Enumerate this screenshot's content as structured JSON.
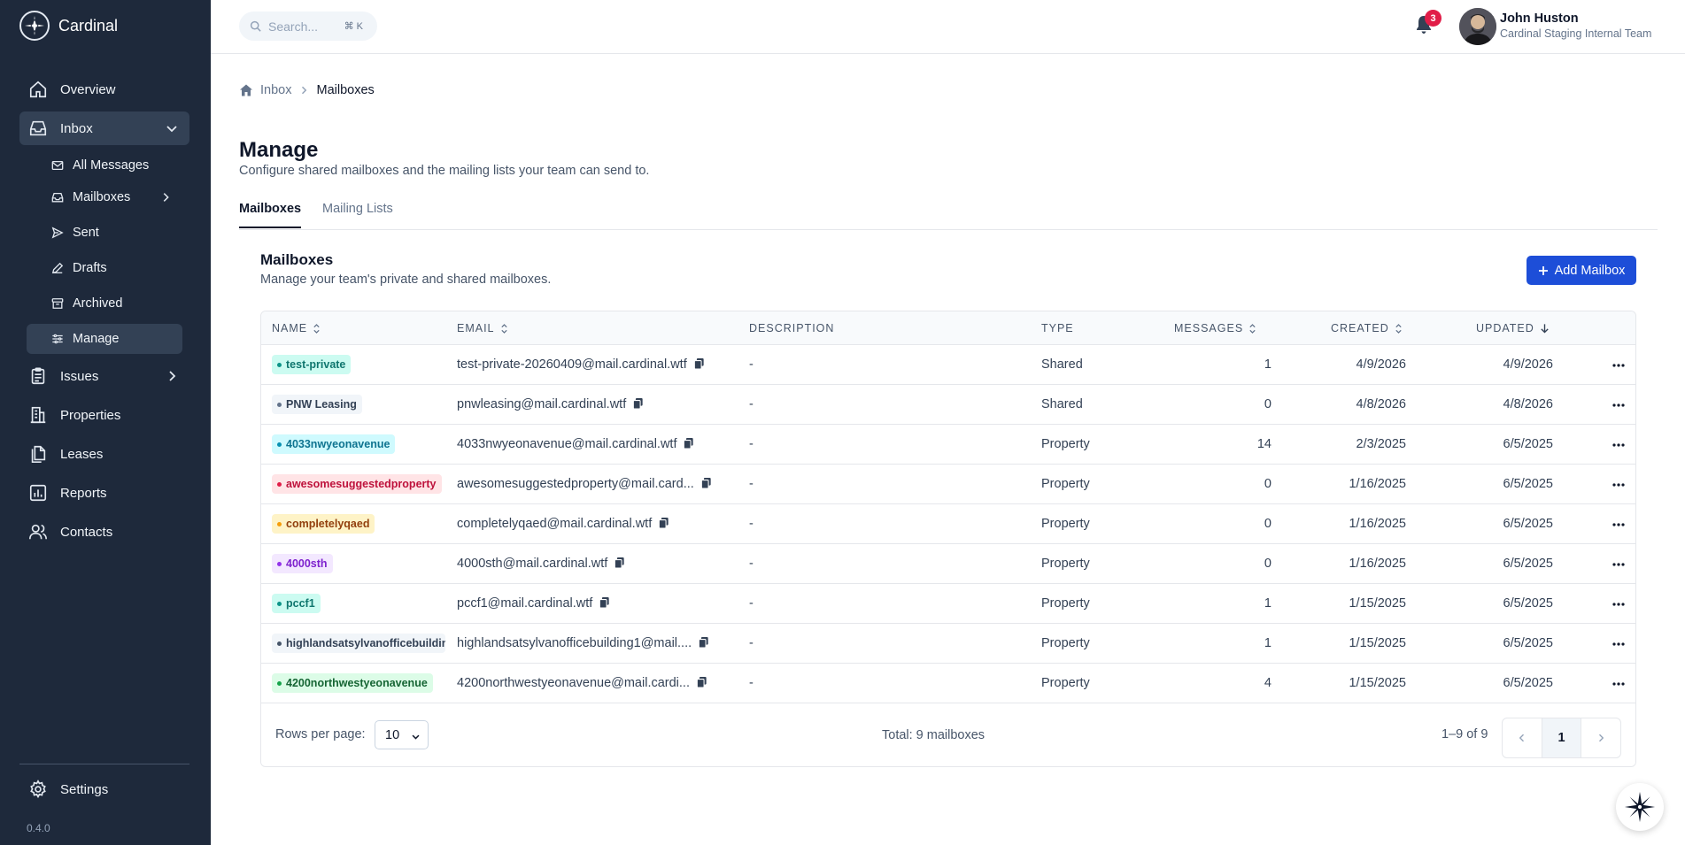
{
  "app": {
    "name": "Cardinal",
    "version": "0.4.0"
  },
  "sidebar": {
    "items": [
      {
        "label": "Overview",
        "icon": "home-icon"
      },
      {
        "label": "Inbox",
        "icon": "inbox-icon"
      },
      {
        "label": "Issues",
        "icon": "clipboard-icon"
      },
      {
        "label": "Properties",
        "icon": "building-icon"
      },
      {
        "label": "Leases",
        "icon": "documents-icon"
      },
      {
        "label": "Reports",
        "icon": "chart-icon"
      },
      {
        "label": "Contacts",
        "icon": "users-icon"
      }
    ],
    "inbox_sub": [
      {
        "label": "All Messages",
        "icon": "mail-icon"
      },
      {
        "label": "Mailboxes",
        "icon": "mailbox-icon"
      },
      {
        "label": "Sent",
        "icon": "send-icon"
      },
      {
        "label": "Drafts",
        "icon": "pencil-icon"
      },
      {
        "label": "Archived",
        "icon": "archive-icon"
      },
      {
        "label": "Manage",
        "icon": "sliders-icon"
      }
    ],
    "settings": "Settings"
  },
  "topbar": {
    "search_placeholder": "Search...",
    "search_shortcut": "⌘ K",
    "notification_count": "3",
    "user_name": "John Huston",
    "user_team": "Cardinal Staging Internal Team"
  },
  "breadcrumb": {
    "home": "Inbox",
    "current": "Mailboxes"
  },
  "page": {
    "title": "Manage",
    "subtitle": "Configure shared mailboxes and the mailing lists your team can send to.",
    "tabs": [
      "Mailboxes",
      "Mailing Lists"
    ]
  },
  "card": {
    "title": "Mailboxes",
    "subtitle": "Manage your team's private and shared mailboxes.",
    "add_button": "Add Mailbox"
  },
  "table": {
    "columns": [
      "NAME",
      "EMAIL",
      "DESCRIPTION",
      "TYPE",
      "MESSAGES",
      "CREATED",
      "UPDATED"
    ],
    "rows": [
      {
        "name": "test-private",
        "color": "#0d9488",
        "bg": "#ccfbf1",
        "fg": "#0f766e",
        "email": "test-private-20260409@mail.cardinal.wtf",
        "description": "-",
        "type": "Shared",
        "messages": "1",
        "created": "4/9/2026",
        "updated": "4/9/2026"
      },
      {
        "name": "PNW Leasing",
        "color": "#64748b",
        "bg": "#f1f5f9",
        "fg": "#334155",
        "email": "pnwleasing@mail.cardinal.wtf",
        "description": "-",
        "type": "Shared",
        "messages": "0",
        "created": "4/8/2026",
        "updated": "4/8/2026"
      },
      {
        "name": "4033nwyeonavenue",
        "color": "#0891b2",
        "bg": "#cffafe",
        "fg": "#0e7490",
        "email": "4033nwyeonavenue@mail.cardinal.wtf",
        "description": "-",
        "type": "Property",
        "messages": "14",
        "created": "2/3/2025",
        "updated": "6/5/2025"
      },
      {
        "name": "awesomesuggestedproperty",
        "color": "#e11d48",
        "bg": "#ffe4e6",
        "fg": "#be123c",
        "email": "awesomesuggestedproperty@mail.card...",
        "description": "-",
        "type": "Property",
        "messages": "0",
        "created": "1/16/2025",
        "updated": "6/5/2025"
      },
      {
        "name": "completelyqaed",
        "color": "#f59e0b",
        "bg": "#fef3c7",
        "fg": "#92400e",
        "email": "completelyqaed@mail.cardinal.wtf",
        "description": "-",
        "type": "Property",
        "messages": "0",
        "created": "1/16/2025",
        "updated": "6/5/2025"
      },
      {
        "name": "4000sth",
        "color": "#9333ea",
        "bg": "#f3e8ff",
        "fg": "#7e22ce",
        "email": "4000sth@mail.cardinal.wtf",
        "description": "-",
        "type": "Property",
        "messages": "0",
        "created": "1/16/2025",
        "updated": "6/5/2025"
      },
      {
        "name": "pccf1",
        "color": "#0d9488",
        "bg": "#ccfbf1",
        "fg": "#0f766e",
        "email": "pccf1@mail.cardinal.wtf",
        "description": "-",
        "type": "Property",
        "messages": "1",
        "created": "1/15/2025",
        "updated": "6/5/2025"
      },
      {
        "name": "highlandsatsylvanofficebuildin",
        "color": "#475569",
        "bg": "#f1f5f9",
        "fg": "#334155",
        "email": "highlandsatsylvanofficebuilding1@mail....",
        "description": "-",
        "type": "Property",
        "messages": "1",
        "created": "1/15/2025",
        "updated": "6/5/2025"
      },
      {
        "name": "4200northwestyeonavenue",
        "color": "#16a34a",
        "bg": "#dcfce7",
        "fg": "#166534",
        "email": "4200northwestyeonavenue@mail.cardi...",
        "description": "-",
        "type": "Property",
        "messages": "4",
        "created": "1/15/2025",
        "updated": "6/5/2025"
      }
    ]
  },
  "footer": {
    "rows_per_page_label": "Rows per page:",
    "rows_per_page_value": "10",
    "total": "Total: 9 mailboxes",
    "range": "1–9 of 9",
    "current_page": "1"
  }
}
